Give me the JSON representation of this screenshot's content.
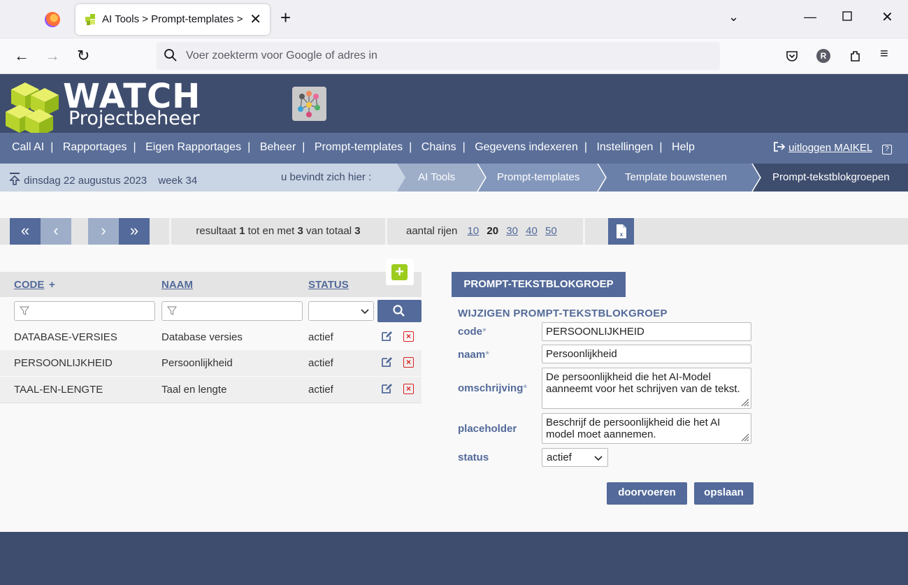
{
  "browser": {
    "tab_title": "AI Tools > Prompt-templates > ",
    "url_placeholder": "Voer zoekterm voor Google of adres in",
    "profile_initial": "R"
  },
  "header": {
    "logo_title": "WATCH",
    "logo_subtitle": "Projectbeheer"
  },
  "menu": {
    "items": [
      "Call AI",
      "Rapportages",
      "Eigen Rapportages",
      "Beheer",
      "Prompt-templates",
      "Chains",
      "Gegevens indexeren",
      "Instellingen",
      "Help"
    ],
    "logout_label": "uitloggen MAIKEL",
    "help_icon_label": "?"
  },
  "breadcrumb": {
    "date": "dinsdag 22 augustus 2023",
    "week": "week 34",
    "here_label": "u bevindt zich hier :",
    "crumbs": [
      "AI Tools",
      "Prompt-templates",
      "Template bouwstenen",
      "Prompt-tekstblokgroepen"
    ]
  },
  "pager": {
    "result_prefix": "resultaat",
    "from": "1",
    "mid1": "tot en met",
    "to": "3",
    "mid2": "van totaal",
    "total": "3",
    "rows_label": "aantal rijen",
    "row_options": [
      "10",
      "20",
      "30",
      "40",
      "50"
    ],
    "selected_rows": "20"
  },
  "list": {
    "columns": {
      "code": "CODE",
      "code_sort": "+",
      "naam": "NAAM",
      "status": "STATUS"
    },
    "rows": [
      {
        "code": "DATABASE-VERSIES",
        "naam": "Database versies",
        "status": "actief"
      },
      {
        "code": "PERSOONLIJKHEID",
        "naam": "Persoonlijkheid",
        "status": "actief"
      },
      {
        "code": "TAAL-EN-LENGTE",
        "naam": "Taal en lengte",
        "status": "actief"
      }
    ]
  },
  "form": {
    "tab": "PROMPT-TEKSTBLOKGROEP",
    "title": "WIJZIGEN PROMPT-TEKSTBLOKGROEP",
    "code_label": "code",
    "code_value": "PERSOONLIJKHEID",
    "naam_label": "naam",
    "naam_value": "Persoonlijkheid",
    "omschrijving_label": "omschrijving",
    "omschrijving_value": "De persoonlijkheid die het AI-Model aanneemt voor het schrijven van de tekst.",
    "placeholder_label": "placeholder",
    "placeholder_value": "Beschrijf de persoonlijkheid die het AI model moet aannemen.",
    "status_label": "status",
    "status_value": "actief",
    "required_mark": "*",
    "submit_label": "doorvoeren",
    "save_label": "opslaan"
  },
  "colors": {
    "header_bg": "#3e4d6e",
    "menu_bg": "#5a6e98",
    "accent": "#536a9a",
    "add_green": "#9ccc1e",
    "delete_red": "#dd2222"
  }
}
